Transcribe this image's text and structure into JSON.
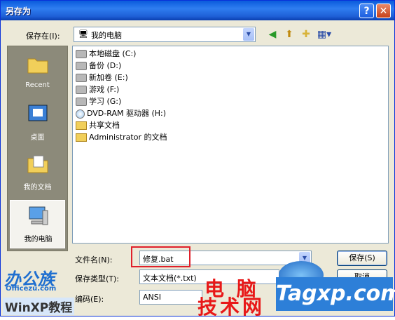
{
  "window": {
    "title": "另存为"
  },
  "toolbar": {
    "save_in_label": "保存在(I):",
    "save_in_value": "我的电脑"
  },
  "places": [
    {
      "label": "Recent"
    },
    {
      "label": "桌面"
    },
    {
      "label": "我的文档"
    },
    {
      "label": "我的电脑"
    }
  ],
  "files": [
    {
      "name": "本地磁盘 (C:)",
      "kind": "drive"
    },
    {
      "name": "备份 (D:)",
      "kind": "drive"
    },
    {
      "name": "新加卷 (E:)",
      "kind": "drive"
    },
    {
      "name": "游戏 (F:)",
      "kind": "drive"
    },
    {
      "name": "学习 (G:)",
      "kind": "drive"
    },
    {
      "name": "DVD-RAM 驱动器 (H:)",
      "kind": "dvd"
    },
    {
      "name": "共享文档",
      "kind": "folder"
    },
    {
      "name": "Administrator 的文档",
      "kind": "folder"
    }
  ],
  "form": {
    "filename_label": "文件名(N):",
    "filename_value": "修复.bat",
    "type_label": "保存类型(T):",
    "type_value": "文本文档(*.txt)",
    "encoding_label": "编码(E):",
    "encoding_value": "ANSI",
    "save_button": "保存(S)",
    "cancel_button": "取消"
  },
  "watermarks": {
    "brand_a": "办公族",
    "brand_a_sub": "Officezu.com",
    "brand_b": "WinXP教程",
    "brand_c1": "电 脑",
    "brand_c2": "技术网",
    "brand_d": "Tagxp.com"
  },
  "colors": {
    "title_bar": "#0a5bdc",
    "highlight_box": "#e0202a",
    "places_bar": "#8c8a7a"
  }
}
